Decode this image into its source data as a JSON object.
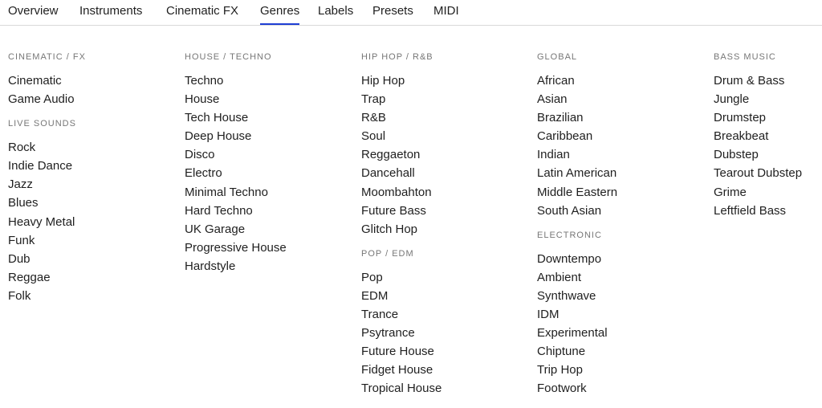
{
  "tabs": [
    {
      "label": "Overview",
      "active": false
    },
    {
      "label": "Instruments",
      "active": false
    },
    {
      "label": "Cinematic FX",
      "active": false
    },
    {
      "label": "Genres",
      "active": true
    },
    {
      "label": "Labels",
      "active": false
    },
    {
      "label": "Presets",
      "active": false
    },
    {
      "label": "MIDI",
      "active": false
    }
  ],
  "accent_color": "#1f3fd4",
  "columns": [
    {
      "groups": [
        {
          "title": "CINEMATIC / FX",
          "items": [
            "Cinematic",
            "Game Audio"
          ]
        },
        {
          "title": "LIVE SOUNDS",
          "items": [
            "Rock",
            "Indie Dance",
            "Jazz",
            "Blues",
            "Heavy Metal",
            "Funk",
            "Dub",
            "Reggae",
            "Folk"
          ]
        }
      ]
    },
    {
      "groups": [
        {
          "title": "HOUSE / TECHNO",
          "items": [
            "Techno",
            "House",
            "Tech House",
            "Deep House",
            "Disco",
            "Electro",
            "Minimal Techno",
            "Hard Techno",
            "UK Garage",
            "Progressive House",
            "Hardstyle"
          ]
        }
      ]
    },
    {
      "groups": [
        {
          "title": "HIP HOP / R&B",
          "items": [
            "Hip Hop",
            "Trap",
            "R&B",
            "Soul",
            "Reggaeton",
            "Dancehall",
            "Moombahton",
            "Future Bass",
            "Glitch Hop"
          ]
        },
        {
          "title": "POP / EDM",
          "items": [
            "Pop",
            "EDM",
            "Trance",
            "Psytrance",
            "Future House",
            "Fidget House",
            "Tropical House"
          ]
        }
      ]
    },
    {
      "groups": [
        {
          "title": "GLOBAL",
          "items": [
            "African",
            "Asian",
            "Brazilian",
            "Caribbean",
            "Indian",
            "Latin American",
            "Middle Eastern",
            "South Asian"
          ]
        },
        {
          "title": "ELECTRONIC",
          "items": [
            "Downtempo",
            "Ambient",
            "Synthwave",
            "IDM",
            "Experimental",
            "Chiptune",
            "Trip Hop",
            "Footwork"
          ]
        }
      ]
    },
    {
      "groups": [
        {
          "title": "BASS MUSIC",
          "items": [
            "Drum & Bass",
            "Jungle",
            "Drumstep",
            "Breakbeat",
            "Dubstep",
            "Tearout Dubstep",
            "Grime",
            "Leftfield Bass"
          ]
        }
      ]
    }
  ]
}
